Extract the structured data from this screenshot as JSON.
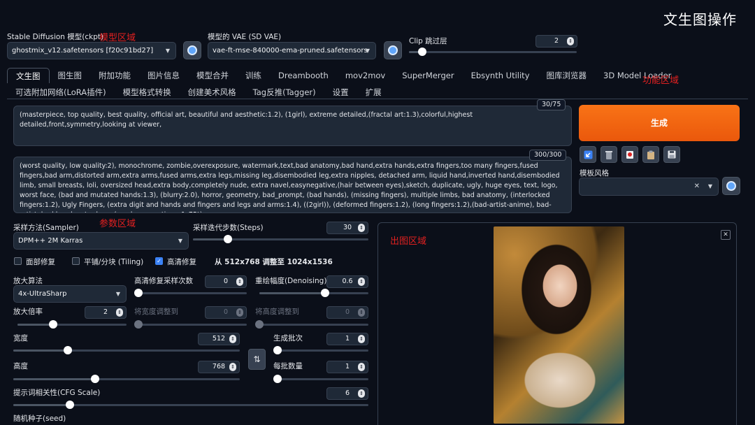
{
  "app_title": "文生图操作",
  "annotations": {
    "model_area": "模型区域",
    "function_area": "功能区域",
    "param_area": "参数区域",
    "output_area": "出图区域"
  },
  "top": {
    "ckpt_label": "Stable Diffusion 模型(ckpt)",
    "ckpt_value": "ghostmix_v12.safetensors [f20c91bd27]",
    "vae_label": "模型的 VAE (SD VAE)",
    "vae_value": "vae-ft-mse-840000-ema-pruned.safetensors",
    "clip_label": "Clip 跳过层",
    "clip_value": "2"
  },
  "tabs_row1": [
    "文生图",
    "图生图",
    "附加功能",
    "图片信息",
    "模型合并",
    "训练",
    "Dreambooth",
    "mov2mov",
    "SuperMerger",
    "Ebsynth Utility",
    "图库浏览器",
    "3D Model Loader"
  ],
  "tabs_row2": [
    "可选附加网络(LoRA插件)",
    "模型格式转换",
    "创建美术风格",
    "Tag反推(Tagger)",
    "设置",
    "扩展"
  ],
  "prompt": {
    "positive": "(masterpiece, top quality, best quality, official art, beautiful and aesthetic:1.2), (1girl), extreme detailed,(fractal art:1.3),colorful,highest detailed,front,symmetry,looking at viewer,",
    "positive_count": "30/75",
    "negative": "(worst quality, low quality:2), monochrome, zombie,overexposure, watermark,text,bad anatomy,bad hand,extra hands,extra fingers,too many fingers,fused fingers,bad arm,distorted arm,extra arms,fused arms,extra legs,missing leg,disembodied leg,extra nipples, detached arm, liquid hand,inverted hand,disembodied limb, small breasts, loli, oversized head,extra body,completely nude, extra navel,easynegative,(hair between eyes),sketch, duplicate, ugly, huge eyes, text, logo, worst face, (bad and mutated hands:1.3), (blurry:2.0), horror, geometry, bad_prompt, (bad hands), (missing fingers), multiple limbs, bad anatomy, (interlocked fingers:1.2), Ugly Fingers, (extra digit and hands and fingers and legs and arms:1.4), ((2girl)), (deformed fingers:1.2), (long fingers:1.2),(bad-artist-anime), bad-artist, bad hand, extra legs ,(ng_deepnegative_v1_75t)",
    "negative_count": "300/300"
  },
  "generate_label": "生成",
  "template_style_label": "模板风格",
  "params": {
    "sampler_label": "采样方法(Sampler)",
    "sampler_value": "DPM++ 2M Karras",
    "steps_label": "采样迭代步数(Steps)",
    "steps_value": "30",
    "face_restore_label": "面部修复",
    "tiling_label": "平铺/分块 (Tiling)",
    "hires_label": "高清修复",
    "hires_info": "从 512x768 调整至 1024x1536",
    "upscaler_label": "放大算法",
    "upscaler_value": "4x-UltraSharp",
    "hires_steps_label": "高清修复采样次数",
    "hires_steps_value": "0",
    "denoise_label": "重绘幅度(Denoising)",
    "denoise_value": "0.6",
    "upscale_by_label": "放大倍率",
    "upscale_by_value": "2",
    "resize_w_label": "将宽度调整到",
    "resize_w_value": "0",
    "resize_h_label": "将高度调整到",
    "resize_h_value": "0",
    "width_label": "宽度",
    "width_value": "512",
    "height_label": "高度",
    "height_value": "768",
    "batch_count_label": "生成批次",
    "batch_count_value": "1",
    "batch_size_label": "每批数量",
    "batch_size_value": "1",
    "cfg_label": "提示词相关性(CFG Scale)",
    "cfg_value": "6",
    "seed_label": "随机种子(seed)"
  },
  "slider_levels": {
    "clip": 0.08,
    "steps": 0.2,
    "hires_steps": 0.0,
    "denoise": 0.6,
    "upscale_by": 0.33,
    "resize_w": 0.0,
    "resize_h": 0.0,
    "width": 0.24,
    "height": 0.36,
    "batch_count": 0.0,
    "batch_size": 0.0,
    "cfg": 0.16
  },
  "icons": {
    "refresh": "refresh-icon",
    "paste": "arrow-paste-icon",
    "trash": "trash-icon",
    "red_dot": "style-apply-icon",
    "clipboard": "clipboard-icon",
    "save": "save-icon",
    "swap": "swap-icon",
    "close": "close-icon"
  },
  "colors": {
    "background": "#0b0f19",
    "generate": "#f97316",
    "annotation_red": "#e02020",
    "checkbox_on": "#3b82f6"
  }
}
